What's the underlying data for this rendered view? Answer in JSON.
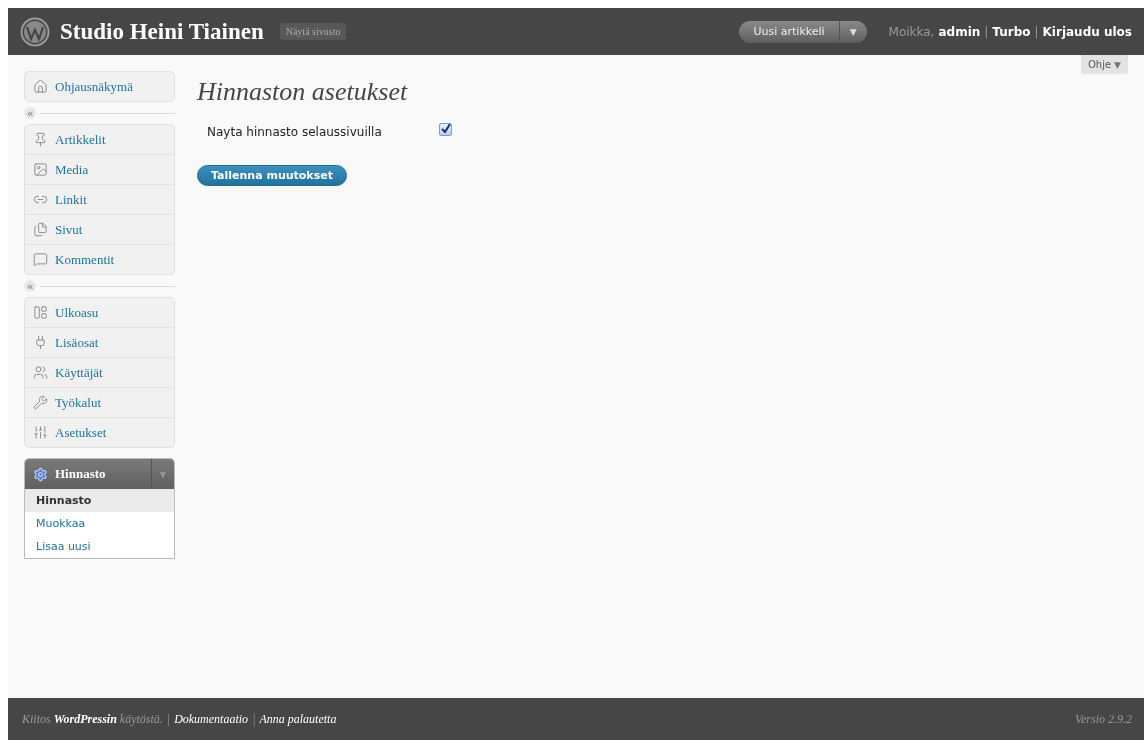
{
  "header": {
    "site_title": "Studio Heini Tiainen",
    "view_site": "Näytä sivusto",
    "new_post": "Uusi artikkeli",
    "new_post_caret": "▼",
    "user_links": [
      {
        "kind": "text",
        "label": "Moikka,"
      },
      {
        "kind": "link",
        "label": "admin"
      },
      {
        "kind": "sep",
        "label": "|"
      },
      {
        "kind": "link",
        "label": "Turbo"
      },
      {
        "kind": "sep",
        "label": "|"
      },
      {
        "kind": "link",
        "label": "Kirjaudu ulos"
      }
    ]
  },
  "help_tab": {
    "label": "Ohje",
    "caret": "▼"
  },
  "sidebar": {
    "groups": [
      {
        "items": [
          {
            "label": "Ohjausnäkymä"
          }
        ]
      },
      {
        "items": [
          {
            "label": "Artikkelit"
          },
          {
            "label": "Media"
          },
          {
            "label": "Linkit"
          },
          {
            "label": "Sivut"
          },
          {
            "label": "Kommentit"
          }
        ]
      },
      {
        "items": [
          {
            "label": "Ulkoasu"
          },
          {
            "label": "Lisäosat"
          },
          {
            "label": "Käyttäjät"
          },
          {
            "label": "Työkalut"
          },
          {
            "label": "Asetukset"
          }
        ]
      }
    ],
    "separator_mark": "«",
    "open_menu": {
      "label": "Hinnasto",
      "caret": "▼",
      "items": [
        {
          "label": "Hinnasto",
          "selected": true
        },
        {
          "label": "Muokkaa",
          "selected": false
        },
        {
          "label": "Lisaa uusi",
          "selected": false
        }
      ]
    }
  },
  "page": {
    "title": "Hinnaston asetukset",
    "option": {
      "label": "Nayta hinnasto selaussivuilla",
      "checked": true
    },
    "save_button": "Tallenna muutokset"
  },
  "footer": {
    "left": [
      {
        "kind": "text",
        "label": "Kiitos **WordPressin** käytöstä."
      },
      {
        "kind": "sep",
        "label": "|"
      },
      {
        "kind": "link",
        "label": "Dokumentaatio"
      },
      {
        "kind": "sep",
        "label": "|"
      },
      {
        "kind": "link",
        "label": "Anna palautetta"
      }
    ],
    "version": "Versio 2.9.2"
  }
}
